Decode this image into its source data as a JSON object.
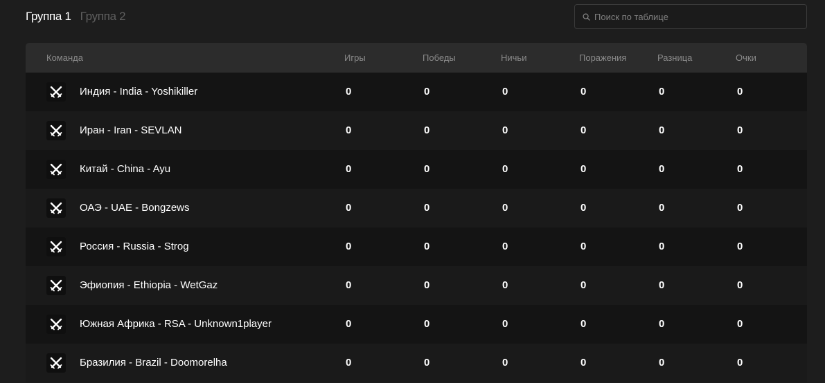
{
  "tabs": [
    {
      "label": "Группа 1",
      "active": true
    },
    {
      "label": "Группа 2",
      "active": false
    }
  ],
  "search": {
    "placeholder": "Поиск по таблице",
    "value": "",
    "icon": "search-icon"
  },
  "table": {
    "columns": [
      "Команда",
      "Игры",
      "Победы",
      "Ничьи",
      "Поражения",
      "Разница",
      "Очки"
    ],
    "logo_icon": "crossed-swords-icon",
    "rows": [
      {
        "team": "Индия - India - Yoshikiller",
        "games": "0",
        "wins": "0",
        "draws": "0",
        "losses": "0",
        "diff": "0",
        "points": "0"
      },
      {
        "team": "Иран - Iran - SEVLAN",
        "games": "0",
        "wins": "0",
        "draws": "0",
        "losses": "0",
        "diff": "0",
        "points": "0"
      },
      {
        "team": "Китай - China - Ayu",
        "games": "0",
        "wins": "0",
        "draws": "0",
        "losses": "0",
        "diff": "0",
        "points": "0"
      },
      {
        "team": "ОАЭ - UAE - Bongzews",
        "games": "0",
        "wins": "0",
        "draws": "0",
        "losses": "0",
        "diff": "0",
        "points": "0"
      },
      {
        "team": "Россия - Russia - Strog",
        "games": "0",
        "wins": "0",
        "draws": "0",
        "losses": "0",
        "diff": "0",
        "points": "0"
      },
      {
        "team": "Эфиопия - Ethiopia - WetGaz",
        "games": "0",
        "wins": "0",
        "draws": "0",
        "losses": "0",
        "diff": "0",
        "points": "0"
      },
      {
        "team": "Южная Африка - RSA - Unknown1player",
        "games": "0",
        "wins": "0",
        "draws": "0",
        "losses": "0",
        "diff": "0",
        "points": "0"
      },
      {
        "team": "Бразилия - Brazil - Doomorelha",
        "games": "0",
        "wins": "0",
        "draws": "0",
        "losses": "0",
        "diff": "0",
        "points": "0"
      }
    ]
  },
  "colors": {
    "background": "#1d1d1d",
    "header": "#2c2c2c",
    "row_odd": "#141414",
    "row_even": "#1a1a1a",
    "muted": "#8a8a8a"
  }
}
